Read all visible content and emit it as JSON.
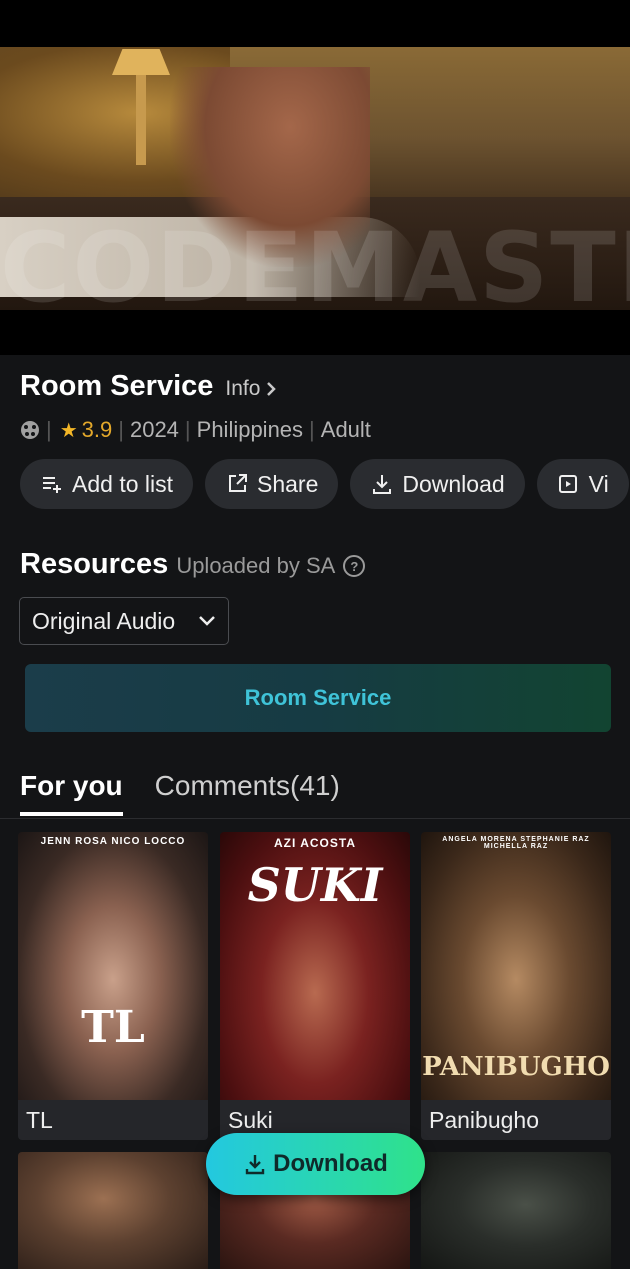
{
  "player": {
    "watermark": "CODEMASTER"
  },
  "movie": {
    "title": "Room Service",
    "info_label": "Info",
    "rating": "3.9",
    "year": "2024",
    "country": "Philippines",
    "genre": "Adult"
  },
  "actions": [
    {
      "label": "Add to list",
      "icon": "add-list-icon"
    },
    {
      "label": "Share",
      "icon": "share-icon"
    },
    {
      "label": "Download",
      "icon": "download-icon"
    },
    {
      "label": "Vi",
      "icon": "video-icon"
    }
  ],
  "resources": {
    "title": "Resources",
    "uploaded_by": "Uploaded by SA",
    "audio_option": "Original Audio",
    "episode_label": "Room Service"
  },
  "tabs": {
    "for_you": "For you",
    "comments": "Comments(41)"
  },
  "recommendations": [
    {
      "title": "TL",
      "poster_credits": "JENN ROSA   NICO LOCCO",
      "poster_title": "TL"
    },
    {
      "title": "Suki",
      "poster_credits": "AZI ACOSTA",
      "poster_title": "SUKI"
    },
    {
      "title": "Panibugho",
      "poster_credits": "ANGELA MORENA  STEPHANIE RAZ  MICHELLA RAZ",
      "poster_title": "PANIBUGHO"
    },
    {
      "title": "",
      "poster_credits": "",
      "poster_title": ""
    },
    {
      "title": "",
      "poster_credits": "",
      "poster_title": ""
    },
    {
      "title": "",
      "poster_credits": "",
      "poster_title": ""
    }
  ],
  "floating_download": {
    "label": "Download"
  },
  "colors": {
    "accent_cyan": "#23c8e0",
    "accent_green": "#2fe28a",
    "rating_star": "#f3b627",
    "background": "#131416"
  }
}
